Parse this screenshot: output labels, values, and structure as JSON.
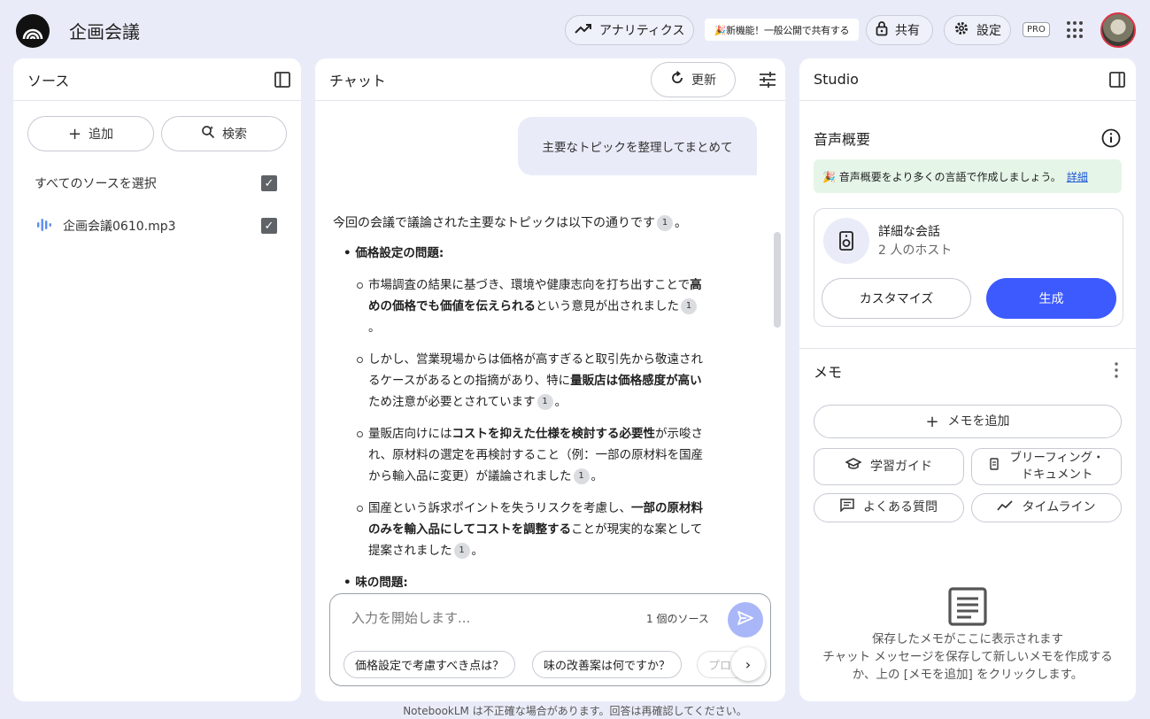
{
  "app": {
    "title": "企画会議"
  },
  "header": {
    "analytics_label": "アナリティクス",
    "promo_label": "🎉新機能！一般公開で共有する",
    "share_label": "共有",
    "settings_label": "設定",
    "pro_badge": "PRO"
  },
  "sources": {
    "title": "ソース",
    "add_label": "追加",
    "search_label": "検索",
    "select_all_label": "すべてのソースを選択",
    "items": [
      {
        "name": "企画会議0610.mp3",
        "checked": true
      }
    ]
  },
  "chat": {
    "title": "チャット",
    "refresh_label": "更新",
    "user_message": "主要なトピックを整理してまとめて",
    "intro": "今回の会議で議論された主要なトピックは以下の通りです",
    "citation": "1",
    "topics": [
      {
        "heading": "価格設定の問題:",
        "points": [
          {
            "pre": "市場調査の結果に基づき、環境や健康志向を打ち出すことで",
            "bold": "高めの価格でも価値を伝えられる",
            "post": "という意見が出されました"
          },
          {
            "pre": "しかし、営業現場からは価格が高すぎると取引先から敬遠されるケースがあるとの指摘があり、特に",
            "bold": "量販店は価格感度が高い",
            "post": "ため注意が必要とされています"
          },
          {
            "pre": "量販店向けには",
            "bold": "コストを抑えた仕様を検討する必要性",
            "post": "が示唆され、原材料の選定を再検討すること（例：一部の原材料を国産から輸入品に変更）が議論されました"
          },
          {
            "pre": "国産という訴求ポイントを失うリスクを考慮し、",
            "bold": "一部の原材料のみを輸入品にしてコストを調整する",
            "post": "ことが現実的な案として提案されました"
          }
        ]
      },
      {
        "heading": "味の問題:",
        "points": []
      }
    ],
    "input_placeholder": "入力を開始します...",
    "source_count": "1 個のソース",
    "suggestions": [
      "価格設定で考慮すべき点は？",
      "味の改善案は何ですか？",
      "プロ"
    ]
  },
  "studio": {
    "title": "Studio",
    "audio_title": "音声概要",
    "banner_text": "🎉 音声概要をより多くの言語で作成しましょう。",
    "banner_link": "詳細",
    "card_title": "詳細な会話",
    "card_subtitle": "2 人のホスト",
    "customize_label": "カスタマイズ",
    "generate_label": "生成",
    "memo_title": "メモ",
    "add_memo_label": "メモを追加",
    "study_guide_label": "学習ガイド",
    "briefing_label": "ブリーフィング・ドキュメント",
    "faq_label": "よくある質問",
    "timeline_label": "タイムライン",
    "empty_title": "保存したメモがここに表示されます",
    "empty_desc": "チャット メッセージを保存して新しいメモを作成するか、上の [メモを追加] をクリックします。"
  },
  "footer": {
    "disclaimer": "NotebookLM は不正確な場合があります。回答は再確認してください。"
  },
  "colors": {
    "accent": "#3d5afe",
    "background": "#e9ecf8",
    "banner": "#e5f5e8"
  }
}
